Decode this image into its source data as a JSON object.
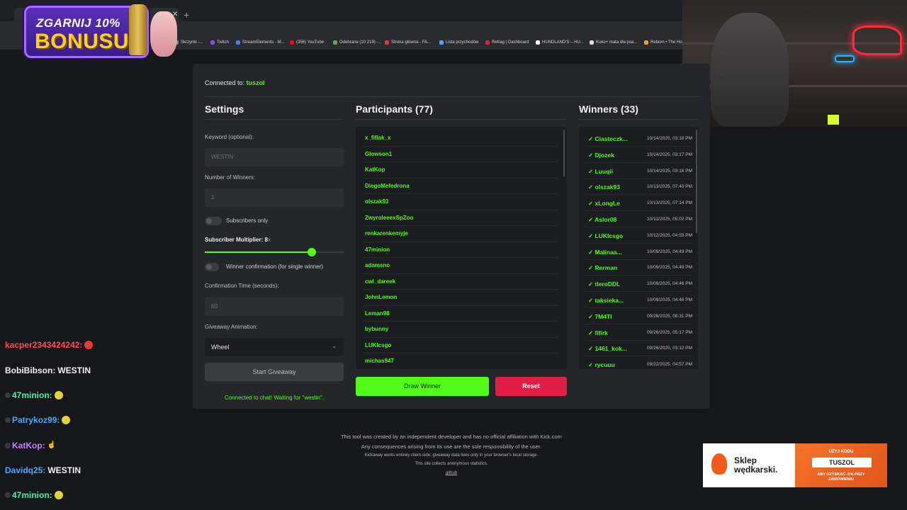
{
  "promo": {
    "line1": "ZGARNIJ 10%",
    "line2": "BONUSU"
  },
  "bookmarks": [
    "Skrzynki -...",
    "Twitch",
    "StreamElements - M...",
    "(356) YouTube",
    "Odebrane (10 219) -...",
    "Strona główna - FA...",
    "Lista przychodów",
    "Refrag | Dashboard",
    "HUNDLAND'S – HU...",
    "Kuko+ mata dla psa...",
    "Reborn • The Ho..."
  ],
  "connection": {
    "label": "Connected to:",
    "channel": "tuszol"
  },
  "settings": {
    "title": "Settings",
    "keyword_label": "Keyword (optional):",
    "keyword_value": "WESTIN",
    "winners_label": "Number of Winners:",
    "winners_value": "1",
    "subs_only_label": "Subscribers only",
    "multiplier_label": "Subscriber Multiplier: 8",
    "multiplier_unit": "x",
    "multiplier_value": 8,
    "multiplier_fraction": 0.77,
    "confirm_label": "Winner confirmation (for single winner)",
    "confirm_time_label": "Confirmation Time (seconds):",
    "confirm_time_value": "60",
    "animation_label": "Giveaway Animation:",
    "animation_value": "Wheel",
    "start_button": "Start Giveaway",
    "status": "Connected to chat! Waiting for \"westin\"."
  },
  "participants": {
    "title": "Participants (77)",
    "items": [
      "x_fiflak_x",
      "Glowson1",
      "KatKop",
      "DiegoMefedrona",
      "olszak93",
      "ZwyrolееexSpZoo",
      "renkarenkemyje",
      "47minion",
      "adamsno",
      "cwl_dareek",
      "JohnLemon",
      "Leman98",
      "bybunny",
      "LUKIcsgo",
      "michas947"
    ],
    "draw_button": "Draw Winner",
    "reset_button": "Reset"
  },
  "winners": {
    "title": "Winners (33)",
    "items": [
      {
        "name": "Ciasteczk...",
        "date": "10/14/2025, 03:18 PM"
      },
      {
        "name": "Djozek",
        "date": "10/14/2025, 03:17 PM"
      },
      {
        "name": "Luuqii",
        "date": "10/14/2025, 03:16 PM"
      },
      {
        "name": "olszak93",
        "date": "10/13/2025, 07:40 PM"
      },
      {
        "name": "xLongLe",
        "date": "10/13/2025, 07:14 PM"
      },
      {
        "name": "Aslor08",
        "date": "10/12/2025, 05:02 PM"
      },
      {
        "name": "LUKIcsgo",
        "date": "10/12/2025, 04:55 PM"
      },
      {
        "name": "Malinaa...",
        "date": "10/09/2025, 04:49 PM"
      },
      {
        "name": "Rerman",
        "date": "10/09/2025, 04:49 PM"
      },
      {
        "name": "tleroDDL",
        "date": "10/09/2025, 04:46 PM"
      },
      {
        "name": "taksieka...",
        "date": "10/09/2025, 04:46 PM"
      },
      {
        "name": "7M4TI",
        "date": "09/28/2025, 08:31 PM"
      },
      {
        "name": "fifirk",
        "date": "09/26/2025, 05:17 PM"
      },
      {
        "name": "1461_kok...",
        "date": "09/26/2025, 03:12 PM"
      },
      {
        "name": "rycuuu",
        "date": "09/22/2025, 04:57 PM"
      }
    ]
  },
  "footer": {
    "line1": "This tool was created by an independent developer and has no official affiliation with Kick.com",
    "line2": "Any consequences arising from its use are the sole responsibility of the user.",
    "line3": "Kickaway works entirely client-side; giveaway data lives only in your browser's local storage.",
    "line4": "This site collects anonymous statistics.",
    "link": "github"
  },
  "chat": [
    {
      "user": "kacper2343424242",
      "color": "#ff4d5e",
      "msg": "",
      "emote": "red"
    },
    {
      "user": "BobiBibson",
      "color": "#f2f2f2",
      "msg": "WESTIN",
      "emote": ""
    },
    {
      "user": "47minion",
      "color": "#4cf0a6",
      "msg": "",
      "emote": "yellow"
    },
    {
      "user": "Patrykoz99",
      "color": "#4aa8ff",
      "msg": "",
      "emote": "yellow"
    },
    {
      "user": "KatKop",
      "color": "#c77dff",
      "msg": "",
      "emote": "hand"
    },
    {
      "user": "Davidq25",
      "color": "#4aa8ff",
      "msg": "WESTIN",
      "emote": ""
    },
    {
      "user": "47minion",
      "color": "#4cf0a6",
      "msg": "",
      "emote": "yellow"
    }
  ],
  "ad": {
    "brand_line1": "Sklep",
    "brand_line2": "wędkarski.",
    "code_label": "UŻYJ KODU",
    "code": "TUSZOL",
    "sub_line1": "ABY UZYSKAĆ -5% PRZY",
    "sub_line2": "ZAMÓWIENIU"
  }
}
